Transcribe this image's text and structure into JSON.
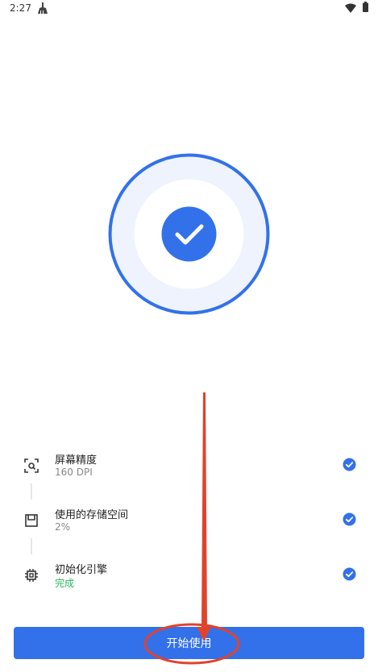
{
  "status_bar": {
    "time": "2:27",
    "app_icon": "broom-icon",
    "wifi_icon": "wifi-icon",
    "battery_icon": "battery-icon"
  },
  "hero": {
    "icon": "check-icon",
    "accent_color": "#3271ea",
    "inner_bg_color": "#eef3fd"
  },
  "checklist": [
    {
      "icon": "screen-scan-icon",
      "title": "屏幕精度",
      "value": "160 DPI",
      "status": "done"
    },
    {
      "icon": "storage-icon",
      "title": "使用的存储空间",
      "value": "2%",
      "status": "done"
    },
    {
      "icon": "chip-icon",
      "title": "初始化引擎",
      "value": "完成",
      "status": "done"
    }
  ],
  "start_button": {
    "label": "开始使用",
    "color": "#3271ea"
  },
  "annotation": {
    "color": "#e0432d",
    "shapes": [
      "arrow",
      "ellipse"
    ]
  }
}
